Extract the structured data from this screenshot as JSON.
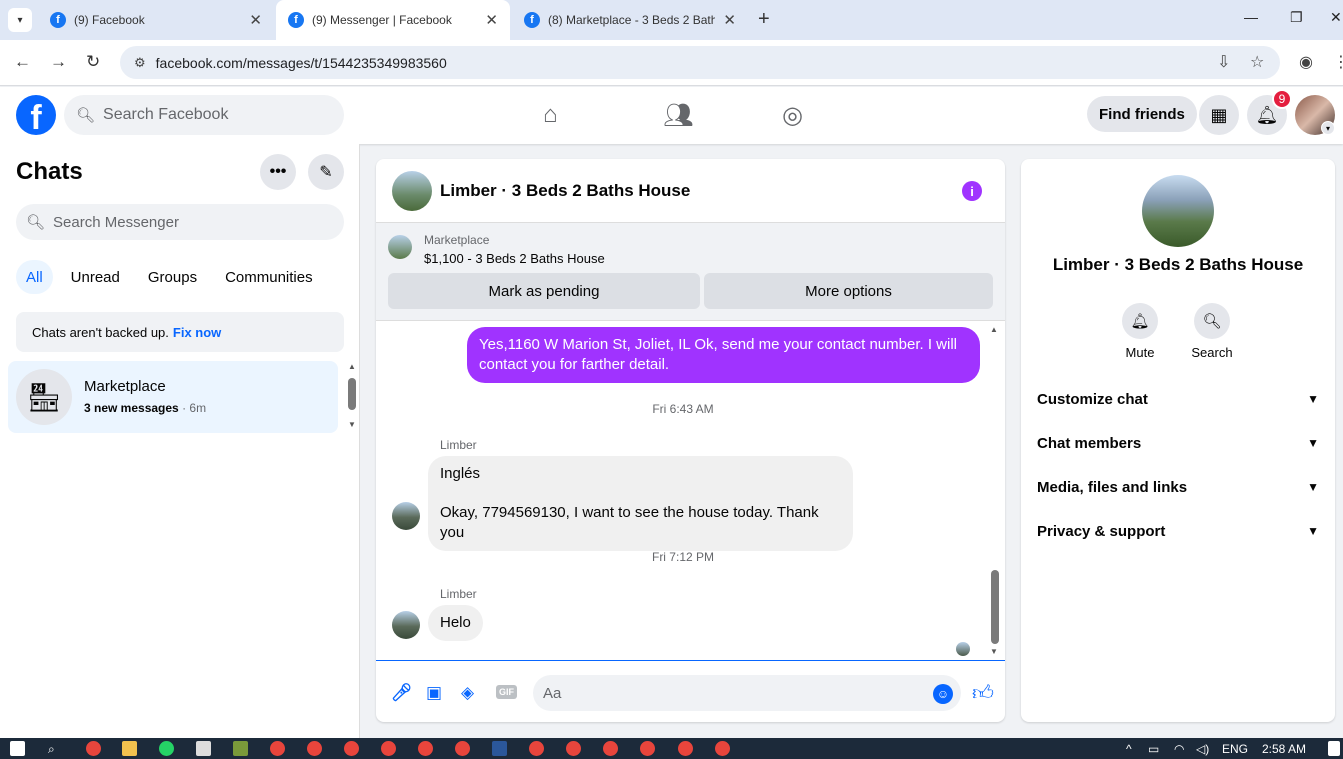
{
  "browser": {
    "tabs": [
      {
        "title": "(9) Facebook",
        "active": false
      },
      {
        "title": "(9) Messenger | Facebook",
        "active": true
      },
      {
        "title": "(8) Marketplace - 3 Beds 2 Bath",
        "active": false
      }
    ],
    "url": "facebook.com/messages/t/1544235349983560"
  },
  "header": {
    "search_placeholder": "Search Facebook",
    "find_friends": "Find friends",
    "notification_count": "9"
  },
  "sidebar": {
    "title": "Chats",
    "search_placeholder": "Search Messenger",
    "filters": [
      "All",
      "Unread",
      "Groups",
      "Communities"
    ],
    "backup_text": "Chats aren't backed up.",
    "backup_link": "Fix now",
    "conversation": {
      "name": "Marketplace",
      "preview": "3 new messages",
      "time": "· 6m"
    }
  },
  "conversation": {
    "title": "Limber · 3 Beds 2 Baths House",
    "marketplace_label": "Marketplace",
    "listing": "$1,100 - 3 Beds 2 Baths House",
    "mark_pending": "Mark as pending",
    "more_options": "More options",
    "outgoing_message": "Yes,1160 W Marion St, Joliet, IL Ok, send me your contact number. I will contact you for farther detail.",
    "stamp1": "Fri 6:43 AM",
    "sender1": "Limber",
    "incoming1_line1": "Inglés",
    "incoming1_line2": "Okay, 7794569130, I want to see the house today. Thank you",
    "stamp2": "Fri 7:12 PM",
    "sender2": "Limber",
    "incoming2": "Helo",
    "composer_placeholder": "Aa"
  },
  "details": {
    "name": "Limber · 3 Beds 2 Baths House",
    "mute": "Mute",
    "search": "Search",
    "sections": [
      "Customize chat",
      "Chat members",
      "Media, files and links",
      "Privacy & support"
    ]
  },
  "taskbar": {
    "lang": "ENG",
    "time": "2:58 AM"
  }
}
